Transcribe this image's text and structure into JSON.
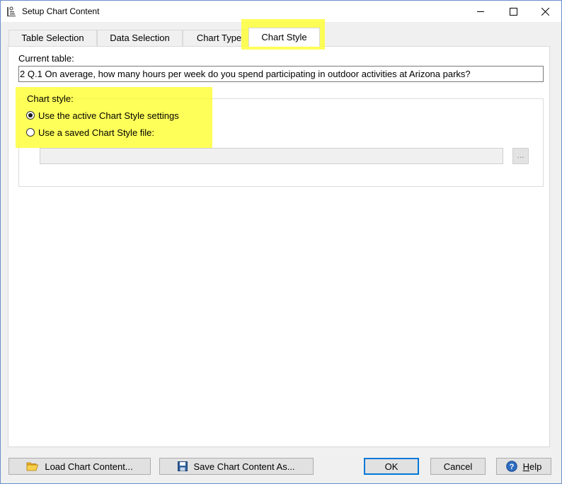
{
  "window": {
    "title": "Setup Chart Content",
    "icon": "chart-settings-icon",
    "controls": [
      "minimize-icon",
      "maximize-icon",
      "close-icon"
    ]
  },
  "tabs": [
    {
      "label": "Table Selection",
      "active": false
    },
    {
      "label": "Data Selection",
      "active": false
    },
    {
      "label": "Chart Type",
      "active": false
    },
    {
      "label": "Chart Style",
      "active": true
    }
  ],
  "current_table": {
    "label": "Current table:",
    "value": "2 Q.1 On average, how many hours per week do you spend participating in outdoor activities at Arizona parks?"
  },
  "chart_style": {
    "group_label": "Chart style:",
    "options": [
      {
        "label": "Use the active Chart Style settings",
        "checked": true
      },
      {
        "label": "Use a saved Chart Style file:",
        "checked": false
      }
    ],
    "file_path": "",
    "browse_label": "..."
  },
  "buttons": {
    "load": "Load Chart Content...",
    "save": "Save Chart Content As...",
    "ok": "OK",
    "cancel": "Cancel",
    "help_prefix": "H",
    "help_rest": "elp"
  },
  "colors": {
    "highlight": "#ffff2a",
    "default_button_border": "#0078d7",
    "window_border": "#6b8fc9"
  }
}
